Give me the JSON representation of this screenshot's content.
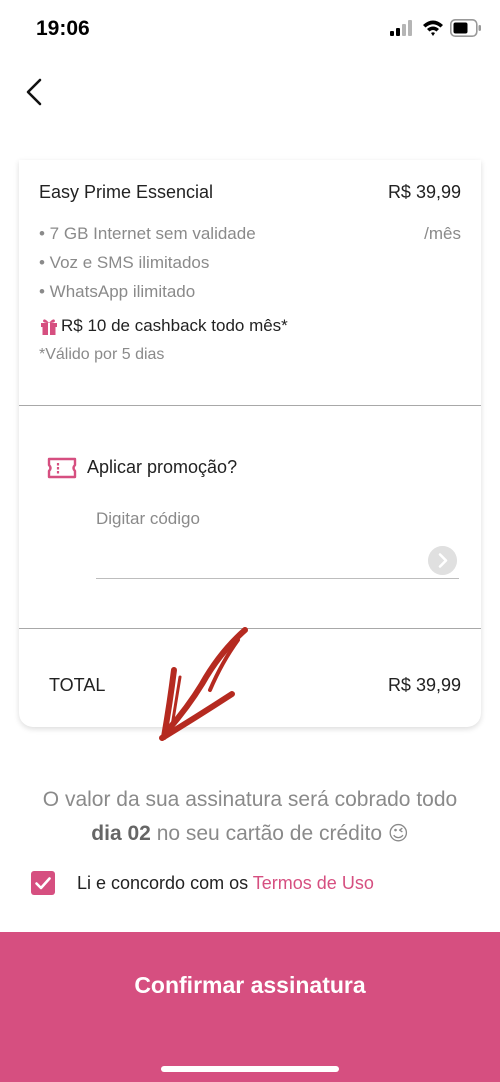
{
  "status_bar": {
    "time": "19:06"
  },
  "plan": {
    "name": "Easy Prime Essencial",
    "price": "R$ 39,99",
    "period": "/mês",
    "features": [
      "• 7 GB Internet sem validade",
      "• Voz e SMS ilimitados",
      "• WhatsApp ilimitado"
    ],
    "cashback": "R$ 10 de cashback todo mês*",
    "validity": "*Válido por 5 dias"
  },
  "promo": {
    "label": "Aplicar promoção?",
    "placeholder": "Digitar código",
    "value": ""
  },
  "total": {
    "label": "TOTAL",
    "value": "R$ 39,99"
  },
  "billing_note": {
    "before": "O valor da sua assinatura será cobrado todo",
    "day": "dia 02",
    "after": "no seu cartão de crédito",
    "emoji": "😉"
  },
  "terms": {
    "checked": true,
    "text": "Li e concordo com os",
    "link": "Termos de Uso"
  },
  "confirm_button": {
    "label": "Confirmar assinatura"
  },
  "colors": {
    "accent": "#d64f80",
    "annotation": "#b52a20"
  },
  "icons": {
    "back": "chevron-left-icon",
    "gift": "gift-icon",
    "promo": "ticket-icon",
    "submit": "chevron-right-icon",
    "checkbox": "checkmark-icon"
  }
}
